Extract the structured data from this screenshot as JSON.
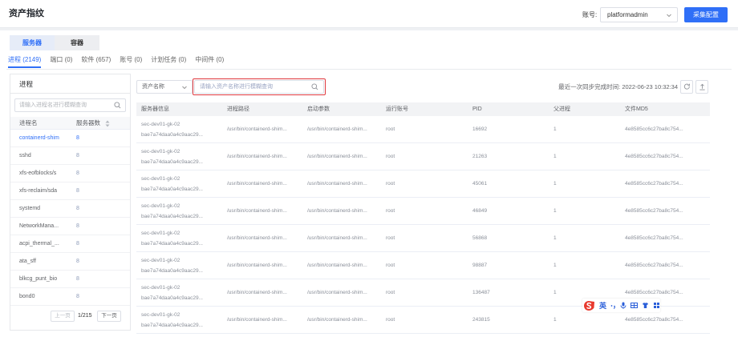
{
  "header": {
    "title": "资产指纹",
    "account_label": "账号:",
    "account_value": "platformadmin",
    "collect_button": "采集配置"
  },
  "tabs": [
    {
      "label": "服务器",
      "active": true
    },
    {
      "label": "容器",
      "active": false
    }
  ],
  "subtabs": [
    {
      "label": "进程 (2149)",
      "active": true
    },
    {
      "label": "端口 (0)",
      "active": false
    },
    {
      "label": "软件 (657)",
      "active": false
    },
    {
      "label": "账号 (0)",
      "active": false
    },
    {
      "label": "计划任务 (0)",
      "active": false
    },
    {
      "label": "中间件 (0)",
      "active": false
    }
  ],
  "process_panel": {
    "title": "进程",
    "search_placeholder": "请输入进程名进行模糊查询",
    "columns": {
      "name": "进程名",
      "count": "服务器数"
    },
    "items": [
      {
        "name": "containerd-shim",
        "count": "8",
        "selected": true
      },
      {
        "name": "sshd",
        "count": "8",
        "selected": false
      },
      {
        "name": "xfs-eofblocks/s",
        "count": "8",
        "selected": false
      },
      {
        "name": "xfs-reclaim/sda",
        "count": "8",
        "selected": false
      },
      {
        "name": "systemd",
        "count": "8",
        "selected": false
      },
      {
        "name": "NetworkMana...",
        "count": "8",
        "selected": false
      },
      {
        "name": "acpi_thermal_...",
        "count": "8",
        "selected": false
      },
      {
        "name": "ata_sff",
        "count": "8",
        "selected": false
      },
      {
        "name": "blkcg_punt_bio",
        "count": "8",
        "selected": false
      },
      {
        "name": "bond0",
        "count": "8",
        "selected": false
      }
    ],
    "pagination": {
      "prev": "上一页",
      "page": "1/215",
      "next": "下一页"
    }
  },
  "detail": {
    "filter_select": "资产名称",
    "search_placeholder": "请输入资产名称进行模糊查询",
    "sync": {
      "label": "最近一次同步完成时间:",
      "time": "2022-06-23 10:32:34"
    },
    "columns": [
      "服务器信息",
      "进程路径",
      "启动参数",
      "运行账号",
      "PID",
      "父进程",
      "文件MD5"
    ],
    "rows": [
      {
        "server_name": "sec-dev01-gk-02",
        "server_id": "bae7a74daa0a4c9aac29...",
        "path": "/usr/bin/containerd-shim...",
        "args": "/usr/bin/containerd-shim...",
        "user": "root",
        "pid": "16692",
        "ppid": "1",
        "md5": "4e8585cc6c27ba8c754..."
      },
      {
        "server_name": "sec-dev01-gk-02",
        "server_id": "bae7a74daa0a4c9aac29...",
        "path": "/usr/bin/containerd-shim...",
        "args": "/usr/bin/containerd-shim...",
        "user": "root",
        "pid": "21263",
        "ppid": "1",
        "md5": "4e8585cc6c27ba8c754..."
      },
      {
        "server_name": "sec-dev01-gk-02",
        "server_id": "bae7a74daa0a4c9aac29...",
        "path": "/usr/bin/containerd-shim...",
        "args": "/usr/bin/containerd-shim...",
        "user": "root",
        "pid": "45061",
        "ppid": "1",
        "md5": "4e8585cc6c27ba8c754..."
      },
      {
        "server_name": "sec-dev01-gk-02",
        "server_id": "bae7a74daa0a4c9aac29...",
        "path": "/usr/bin/containerd-shim...",
        "args": "/usr/bin/containerd-shim...",
        "user": "root",
        "pid": "46849",
        "ppid": "1",
        "md5": "4e8585cc6c27ba8c754..."
      },
      {
        "server_name": "sec-dev01-gk-02",
        "server_id": "bae7a74daa0a4c9aac29...",
        "path": "/usr/bin/containerd-shim...",
        "args": "/usr/bin/containerd-shim...",
        "user": "root",
        "pid": "56868",
        "ppid": "1",
        "md5": "4e8585cc6c27ba8c754..."
      },
      {
        "server_name": "sec-dev01-gk-02",
        "server_id": "bae7a74daa0a4c9aac29...",
        "path": "/usr/bin/containerd-shim...",
        "args": "/usr/bin/containerd-shim...",
        "user": "root",
        "pid": "98887",
        "ppid": "1",
        "md5": "4e8585cc6c27ba8c754..."
      },
      {
        "server_name": "sec-dev01-gk-02",
        "server_id": "bae7a74daa0a4c9aac29...",
        "path": "/usr/bin/containerd-shim...",
        "args": "/usr/bin/containerd-shim...",
        "user": "root",
        "pid": "136487",
        "ppid": "1",
        "md5": "4e8585cc6c27ba8c754..."
      },
      {
        "server_name": "sec-dev01-gk-02",
        "server_id": "bae7a74daa0a4c9aac29...",
        "path": "/usr/bin/containerd-shim...",
        "args": "/usr/bin/containerd-shim...",
        "user": "root",
        "pid": "243815",
        "ppid": "1",
        "md5": "4e8585cc6c27ba8c754..."
      }
    ]
  },
  "ime_bar": {
    "logo_text": "S",
    "language": "英"
  },
  "icons": {
    "account_select": "chevron-down-icon",
    "filter_select": "chevron-down-icon",
    "search": "search-icon",
    "sort": "sort-icon",
    "refresh": "refresh-icon",
    "export": "export-icon",
    "ime": [
      "sogou-logo-icon",
      "punctuation-icon",
      "microphone-icon",
      "keyboard-icon",
      "skin-icon",
      "toolbox-icon"
    ]
  },
  "colors": {
    "accent": "#2f6ff7",
    "highlight_border": "#e0393e",
    "ime_logo": "#e8392e",
    "ime_icon": "#2b5fd9"
  }
}
